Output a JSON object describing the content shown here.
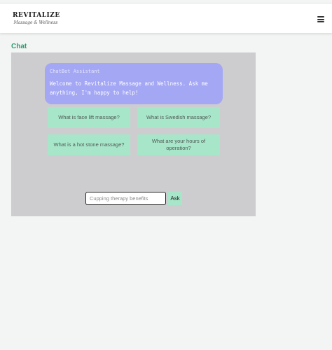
{
  "header": {
    "logo_title": "REVITALIZE",
    "logo_tagline": "Massage & Wellness",
    "menu_icon": "hamburger-menu-icon"
  },
  "page": {
    "section_title": "Chat"
  },
  "chat": {
    "sender": "ChatBot Assistant",
    "message": "Welcome to Revitalize Massage and Wellness. Ask me anything, I'm happy to help!",
    "suggestions": [
      "What is face lift massage?",
      "What is Swedish massage?",
      "What is a hot stone massage?",
      "What are your hours of operation?"
    ],
    "input_placeholder": "Cupping therapy benefits",
    "input_value": "",
    "ask_label": "Ask"
  },
  "colors": {
    "accent_green": "#2e9d6e",
    "suggestion_bg": "#a8e6c9",
    "bubble_bg": "#a3a7f4",
    "panel_bg": "#cdcdcf"
  }
}
